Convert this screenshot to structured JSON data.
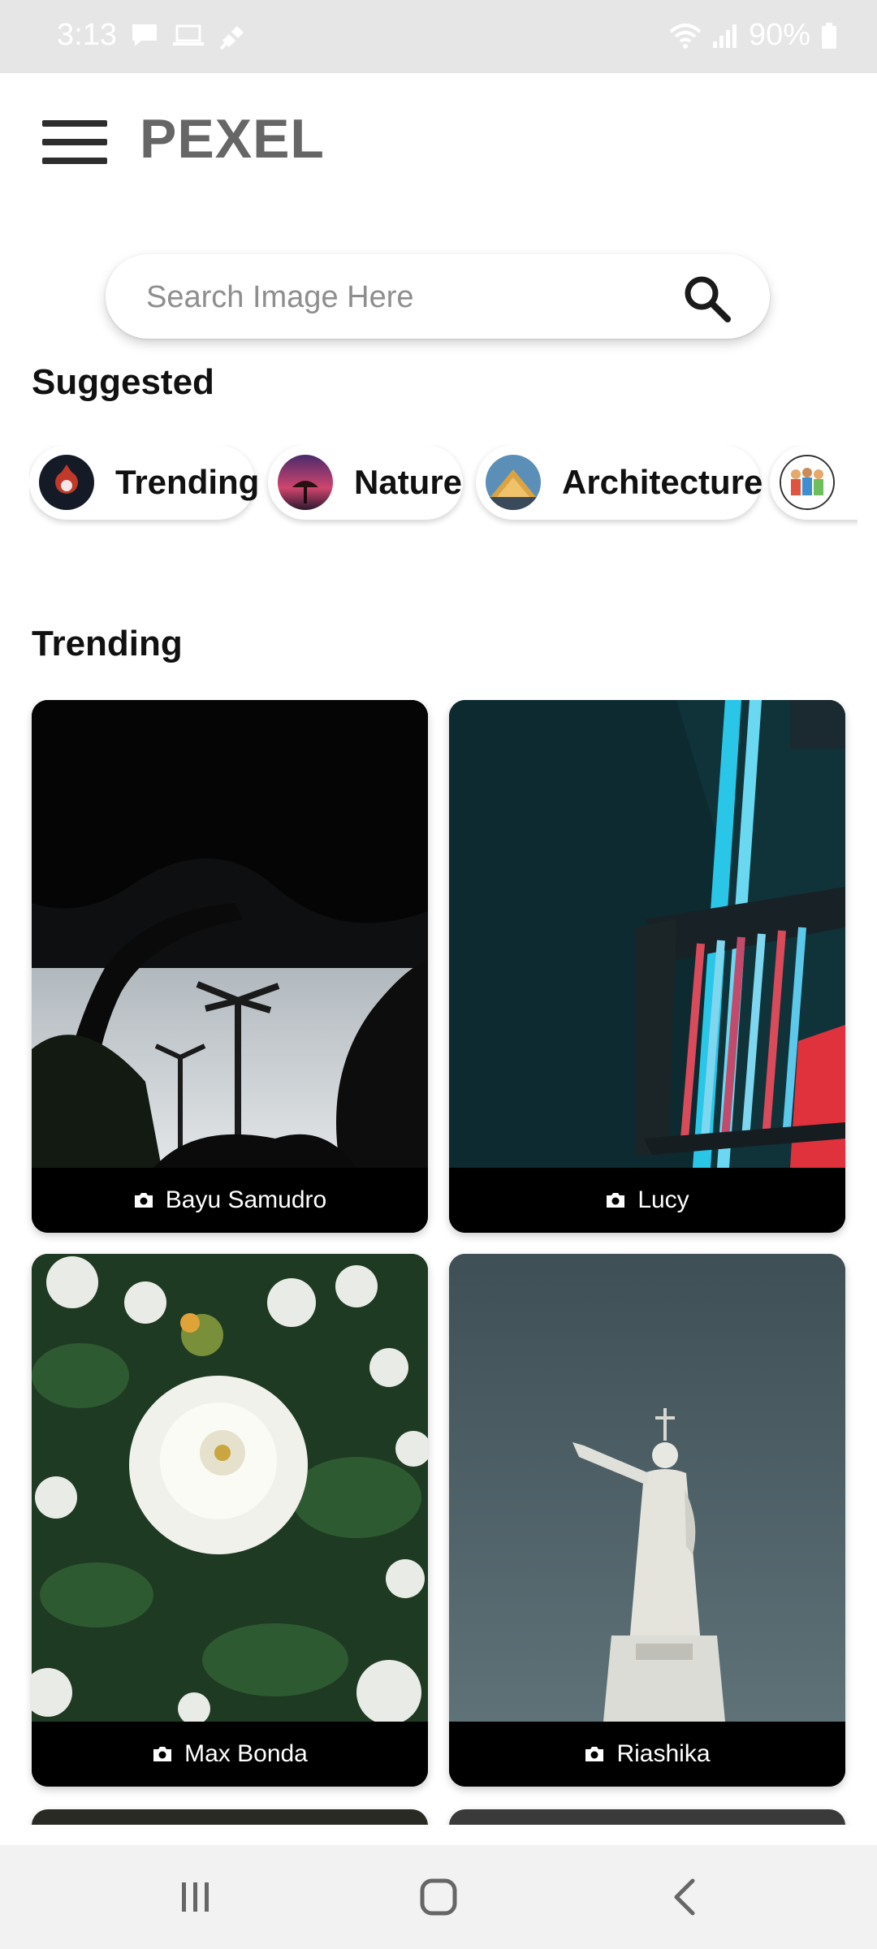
{
  "status_bar": {
    "time": "3:13",
    "battery": "90%",
    "icons": [
      "chat-icon",
      "laptop-icon",
      "mute-icon",
      "wifi-icon",
      "signal-icon",
      "battery-icon"
    ]
  },
  "app": {
    "title": "PEXEL",
    "menu_icon": "menu-icon"
  },
  "search": {
    "placeholder": "Search Image Here",
    "value": "",
    "icon": "search-icon"
  },
  "suggested": {
    "heading": "Suggested",
    "chips": [
      {
        "label": "Trending"
      },
      {
        "label": "Nature"
      },
      {
        "label": "Architecture"
      },
      {
        "label": ""
      }
    ]
  },
  "trending": {
    "heading": "Trending",
    "cards": [
      {
        "photographer": "Bayu Samudro"
      },
      {
        "photographer": "Lucy"
      },
      {
        "photographer": "Max Bonda"
      },
      {
        "photographer": "Riashika"
      }
    ]
  },
  "nav_bar": {
    "buttons": [
      "recents-icon",
      "home-icon",
      "back-icon"
    ]
  },
  "colors": {
    "status_bar_bg": "#e6e6e6",
    "title": "#666666",
    "caption_bg": "#000000",
    "nav_bg": "#f2f2f2"
  }
}
